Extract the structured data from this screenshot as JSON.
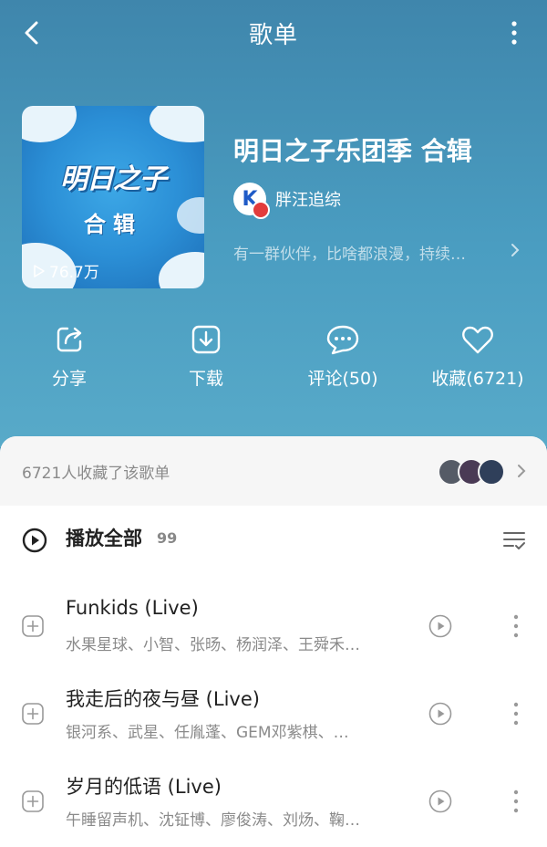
{
  "header": {
    "title": "歌单"
  },
  "playlist": {
    "name": "明日之子乐团季 合辑",
    "cover_logo": "明日之子",
    "cover_subtitle": "合辑",
    "plays": "76.7万",
    "creator": "胖汪追综",
    "creator_avatar_letter": "K",
    "description": "有一群伙伴，比啥都浪漫，持续…"
  },
  "actions": {
    "share": "分享",
    "download": "下载",
    "comment": "评论(50)",
    "favorite": "收藏(6721)"
  },
  "collectors": {
    "text": "6721人收藏了该歌单"
  },
  "play_all": {
    "label": "播放全部",
    "count": "99"
  },
  "songs": [
    {
      "title": "Funkids (Live)",
      "artists": "水果星球、小智、张旸、杨润泽、王舜禾…"
    },
    {
      "title": "我走后的夜与昼 (Live)",
      "artists": "银河系、武星、任胤蓬、GEM邓紫棋、…"
    },
    {
      "title": "岁月的低语 (Live)",
      "artists": "午睡留声机、沈钲博、廖俊涛、刘炀、鞠…"
    }
  ],
  "colors": {
    "hero_top": "#3f86ac",
    "hero_bottom": "#58aac9",
    "text_secondary": "#8a8a8a"
  }
}
